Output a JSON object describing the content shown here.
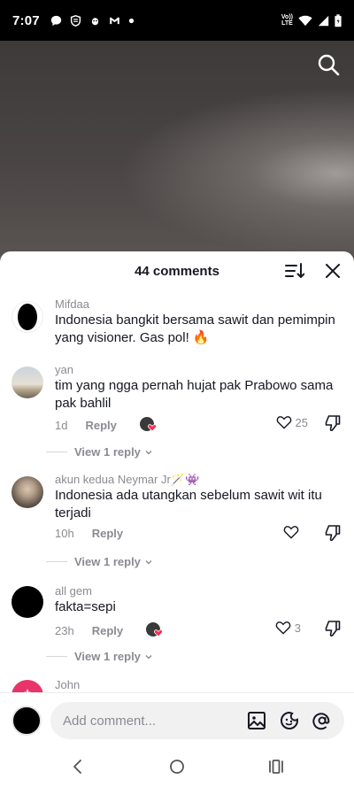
{
  "status_bar": {
    "time": "7:07",
    "network_top": "Vo))",
    "network_bottom": "LTE",
    "icons": [
      "chat-bubble-icon",
      "shield-icon",
      "bug-icon",
      "gmail-icon",
      "dot-icon",
      "wifi-icon",
      "signal-icon",
      "battery-icon"
    ]
  },
  "video": {
    "search_icon": "search-icon"
  },
  "sheet": {
    "title": "44 comments"
  },
  "comments": [
    {
      "username": "Mifdaa",
      "text": "Indonesia bangkit bersama sawit dan pemimpin yang visioner. Gas pol! 🔥"
    },
    {
      "username": "yan",
      "text": "tim yang ngga pernah hujat pak Prabowo sama pak bahlil",
      "time": "1d",
      "reply_label": "Reply",
      "likes": "25",
      "view_replies": "View 1 reply"
    },
    {
      "username": "akun kedua Neymar Jr🪄👾",
      "text": "Indonesia ada utangkan sebelum sawit wit itu terjadi",
      "time": "10h",
      "reply_label": "Reply",
      "view_replies": "View 1 reply"
    },
    {
      "username": "all gem",
      "text": "fakta=sepi",
      "time": "23h",
      "reply_label": "Reply",
      "likes": "3",
      "view_replies": "View 1 reply"
    },
    {
      "username": "John"
    }
  ],
  "composer": {
    "placeholder": "Add comment..."
  },
  "colors": {
    "accent_pink": "#fe2c55",
    "muted_text": "#8a8b91"
  }
}
